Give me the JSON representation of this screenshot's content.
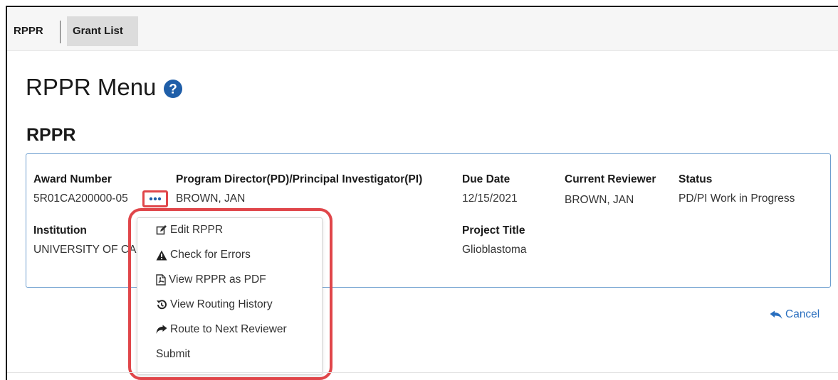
{
  "breadcrumb": {
    "rppr": "RPPR",
    "grant_list": "Grant List"
  },
  "page": {
    "title": "RPPR Menu",
    "section_title": "RPPR"
  },
  "award": {
    "award_number_label": "Award Number",
    "award_number": "5R01CA200000-05",
    "pd_pi_label": "Program Director(PD)/Principal Investigator(PI)",
    "pd_pi": "BROWN, JAN",
    "due_date_label": "Due Date",
    "due_date": "12/15/2021",
    "current_reviewer_label": "Current Reviewer",
    "current_reviewer": "BROWN, JAN",
    "status_label": "Status",
    "status": "PD/PI Work in Progress",
    "institution_label": "Institution",
    "institution": "UNIVERSITY OF CA",
    "project_title_label": "Project Title",
    "project_title": "Glioblastoma"
  },
  "menu": {
    "items": [
      {
        "label": "Edit RPPR",
        "icon": "edit-icon"
      },
      {
        "label": "Check for Errors",
        "icon": "warning-icon"
      },
      {
        "label": "View RPPR as PDF",
        "icon": "pdf-icon"
      },
      {
        "label": "View Routing History",
        "icon": "history-icon"
      },
      {
        "label": "Route to Next Reviewer",
        "icon": "share-arrow-icon"
      },
      {
        "label": "Submit",
        "icon": ""
      }
    ]
  },
  "cancel_label": "Cancel",
  "colors": {
    "accent": "#2a6fbf",
    "highlight": "#e0464a",
    "card_border": "#6d9ecf"
  }
}
